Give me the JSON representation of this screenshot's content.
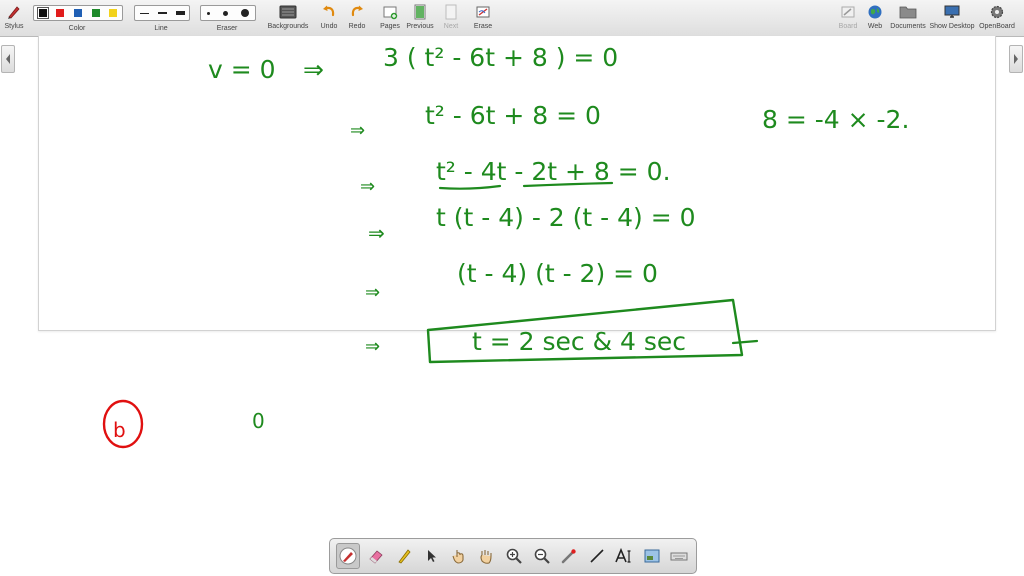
{
  "toolbar": {
    "stylus": "Stylus",
    "color": "Color",
    "line": "Line",
    "eraser": "Eraser",
    "backgrounds": "Backgrounds",
    "undo": "Undo",
    "redo": "Redo",
    "pages": "Pages",
    "previous": "Previous",
    "next": "Next",
    "erase": "Erase",
    "board": "Board",
    "web": "Web",
    "documents": "Documents",
    "show_desktop": "Show Desktop",
    "openboard": "OpenBoard"
  },
  "colors": {
    "swatches": [
      "#111111",
      "#e01b1b",
      "#1f5fb4",
      "#1e8a2a",
      "#f2d21b"
    ],
    "ink_green": "#1e8a1e",
    "ink_red": "#e01010"
  },
  "handwriting": {
    "line1_left": "v = 0",
    "line1_arrow": "⇒",
    "line1_right": "3 ( t² - 6t + 8 ) = 0",
    "line2_arrow": "⇒",
    "line2": "t² - 6t + 8 = 0",
    "side_note": "8 = -4 × -2.",
    "line3_arrow": "⇒",
    "line3": "t² - 4t - 2t + 8 = 0.",
    "line4_arrow": "⇒",
    "line4": "t (t - 4)  - 2 (t - 4) = 0",
    "line5_arrow": "⇒",
    "line5": "(t - 4)  (t - 2) = 0",
    "line6_arrow": "⇒",
    "answer": "t = 2 sec  &  4 sec",
    "part_label": "b",
    "stray_mark": "0"
  },
  "palette": {
    "tools": [
      "pen-icon",
      "eraser-icon",
      "marker-icon",
      "selector-icon",
      "interact-hand-icon",
      "pan-hand-icon",
      "zoom-in-icon",
      "zoom-out-icon",
      "laser-pointer-icon",
      "line-icon",
      "text-icon",
      "capture-icon",
      "virtual-keyboard-icon"
    ],
    "active": "pen-icon"
  }
}
